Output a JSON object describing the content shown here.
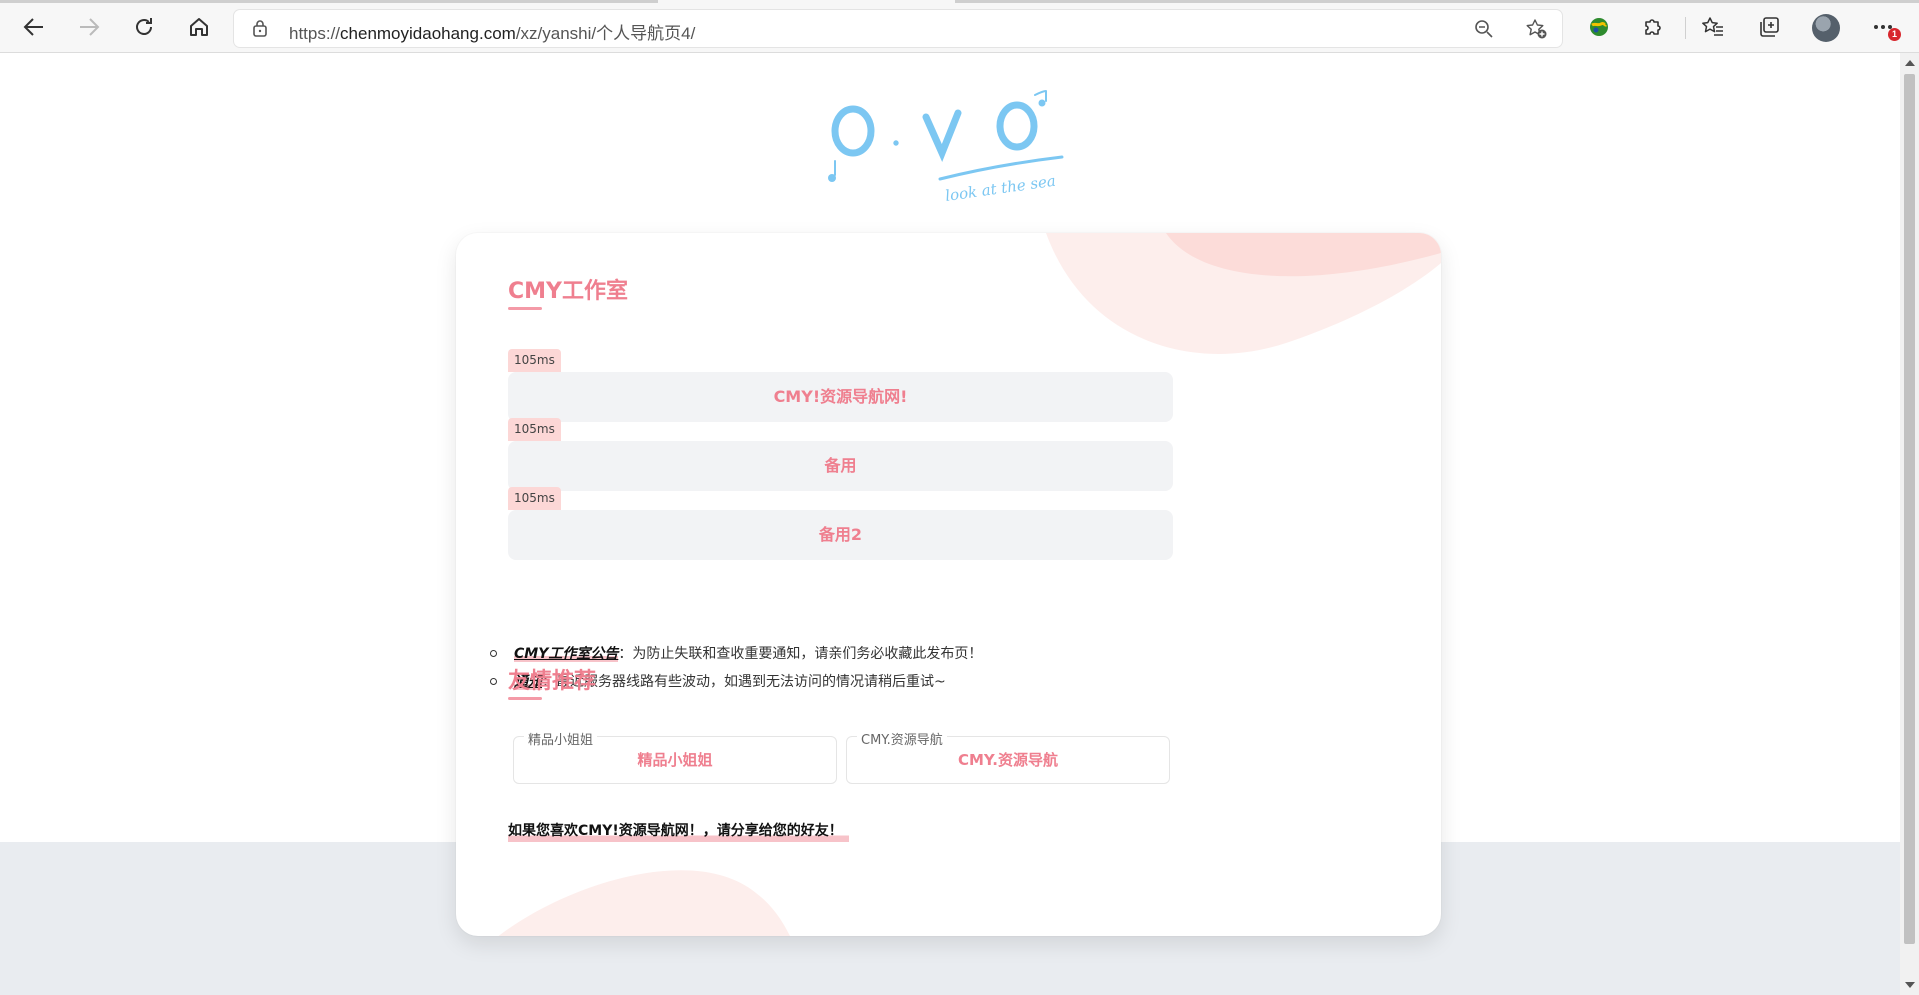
{
  "browser": {
    "url_prefix": "https://",
    "url_host": "chenmoyidaohang.com",
    "url_path": "/xz/yanshi/个人导航页4/",
    "notification_count": "1",
    "icons": [
      "back-icon",
      "forward-icon",
      "refresh-icon",
      "home-icon",
      "lock-icon",
      "zoom-out-icon",
      "add-favorite-icon",
      "extension-globe-icon",
      "extensions-puzzle-icon",
      "favorites-icon",
      "collections-icon",
      "profile-avatar",
      "more-icon"
    ]
  },
  "logo": {
    "text": "O.V O",
    "tagline": "look at the sea",
    "color": "#7cc7f2"
  },
  "studio": {
    "title": "CMY工作室",
    "links": [
      {
        "ping": "105ms",
        "label": "CMY!资源导航网!"
      },
      {
        "ping": "105ms",
        "label": "备用"
      },
      {
        "ping": "105ms",
        "label": "备用2"
      }
    ]
  },
  "notices": [
    {
      "key": "CMY工作室公告",
      "sep": "：",
      "text": "为防止失联和查收重要通知，请亲们务必收藏此发布页！"
    },
    {
      "key": "通知",
      "sep": "：",
      "text": "最近服务器线路有些波动，如遇到无法访问的情况请稍后重试~"
    }
  ],
  "friends": {
    "title": "友情推荐",
    "items": [
      {
        "caption": "精品小姐姐",
        "name": "精品小姐姐"
      },
      {
        "caption": "CMY.资源导航",
        "name": "CMY.资源导航"
      }
    ]
  },
  "share_text": "如果您喜欢CMY!资源导航网！，请分享给您的好友！",
  "colors": {
    "accent": "#ef7f8f",
    "ping_bg": "#fcd7d6",
    "button_bg": "#f2f3f5",
    "lower_bg": "#e9ecf0"
  }
}
